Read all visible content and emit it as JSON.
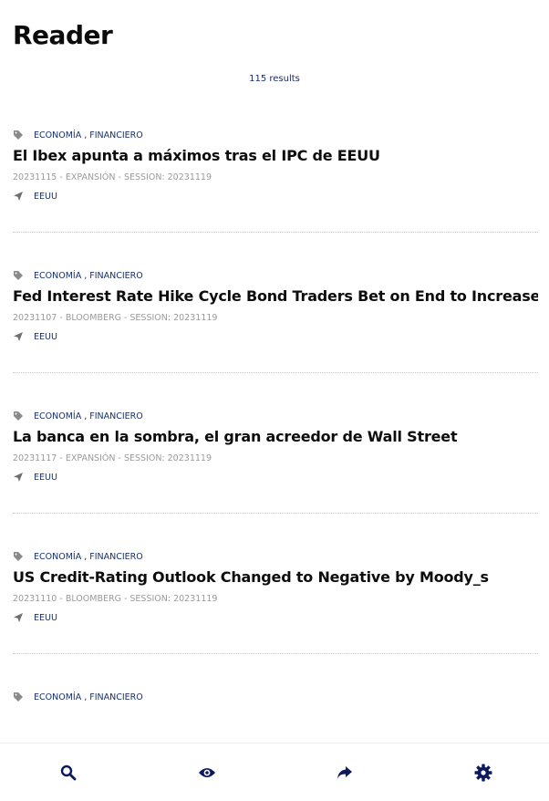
{
  "header": {
    "title": "Reader",
    "results": "115 results"
  },
  "colors": {
    "accent": "#17306b",
    "meta": "#9a9a9a",
    "icon_gray": "#8a8a8a",
    "nav_icon": "#0b1a5e"
  },
  "articles": [
    {
      "tags": "ECONOMÍA , FINANCIERO",
      "title": "El Ibex apunta a máximos tras el IPC de EEUU",
      "meta": "20231115 - EXPANSIÓN - SESSION: 20231119",
      "location": "EEUU"
    },
    {
      "tags": "ECONOMÍA , FINANCIERO",
      "title": "Fed Interest Rate Hike Cycle Bond Traders Bet on End to Increases",
      "meta": "20231107 - BLOOMBERG - SESSION: 20231119",
      "location": "EEUU"
    },
    {
      "tags": "ECONOMÍA , FINANCIERO",
      "title": "La banca en la sombra, el gran acreedor de Wall Street",
      "meta": "20231117 - EXPANSIÓN - SESSION: 20231119",
      "location": "EEUU"
    },
    {
      "tags": "ECONOMÍA , FINANCIERO",
      "title": "US Credit-Rating Outlook Changed to Negative by Moody_s",
      "meta": "20231110 - BLOOMBERG - SESSION: 20231119",
      "location": "EEUU"
    },
    {
      "tags": "ECONOMÍA , FINANCIERO"
    }
  ],
  "bottom_nav": [
    {
      "icon": "search-icon"
    },
    {
      "icon": "eye-icon"
    },
    {
      "icon": "share-icon"
    },
    {
      "icon": "gear-icon"
    }
  ]
}
